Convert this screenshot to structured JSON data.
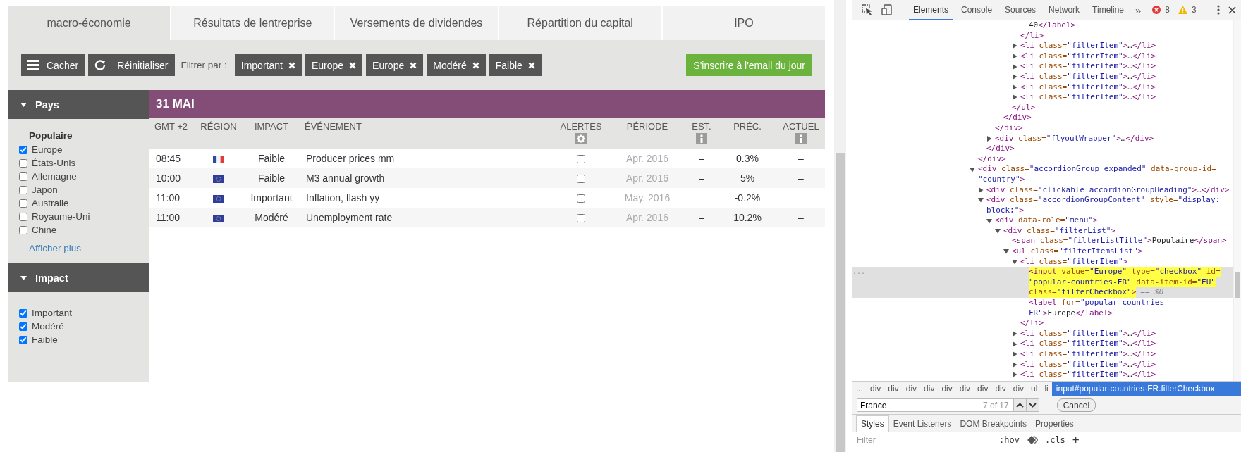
{
  "page": {
    "tabs": [
      {
        "label": "macro-économie",
        "selected": true
      },
      {
        "label": "Résultats de lentreprise",
        "selected": false
      },
      {
        "label": "Versements de dividendes",
        "selected": false
      },
      {
        "label": "Répartition du capital",
        "selected": false
      },
      {
        "label": "IPO",
        "selected": false
      }
    ],
    "toolbar": {
      "hide_button": "Cacher",
      "reset_button": "Réinitialiser",
      "filter_label": "Filtrer par :",
      "filters": [
        "Important",
        "Europe",
        "Europe",
        "Modéré",
        "Faible"
      ],
      "subscribe_button": "S'inscrire à l'email du jour"
    },
    "sidebar": [
      {
        "title": "Pays",
        "expanded": true,
        "subtitle": "Populaire",
        "items": [
          {
            "label": "Europe",
            "checked": true
          },
          {
            "label": "États-Unis",
            "checked": false
          },
          {
            "label": "Allemagne",
            "checked": false
          },
          {
            "label": "Japon",
            "checked": false
          },
          {
            "label": "Australie",
            "checked": false
          },
          {
            "label": "Royaume-Uni",
            "checked": false
          },
          {
            "label": "Chine",
            "checked": false
          }
        ],
        "more_link": "Afficher plus"
      },
      {
        "title": "Impact",
        "expanded": true,
        "items": [
          {
            "label": "Important",
            "checked": true
          },
          {
            "label": "Modéré",
            "checked": true
          },
          {
            "label": "Faible",
            "checked": true
          }
        ]
      }
    ],
    "calendar": {
      "date": "31 MAI",
      "columns": [
        {
          "label": "GMT +2",
          "kind": "plain"
        },
        {
          "label": "RÉGION",
          "kind": "plain"
        },
        {
          "label": "IMPACT",
          "kind": "plain"
        },
        {
          "label": "ÉVÉNEMENT",
          "kind": "plain"
        },
        {
          "label": "ALERTES",
          "kind": "settings"
        },
        {
          "label": "PÉRIODE",
          "kind": "plain"
        },
        {
          "label": "EST.",
          "kind": "info"
        },
        {
          "label": "PRÉC.",
          "kind": "plain"
        },
        {
          "label": "ACTUEL",
          "kind": "info"
        }
      ],
      "rows": [
        {
          "time": "08:45",
          "region": {
            "kind": "fr"
          },
          "impact": "Faible",
          "event": "Producer prices mm",
          "alert": false,
          "period": "Apr. 2016",
          "estimate": "–",
          "previous": "0.3%",
          "actual": "–"
        },
        {
          "time": "10:00",
          "region": {
            "kind": "eu"
          },
          "impact": "Faible",
          "event": "M3 annual growth",
          "alert": false,
          "period": "Apr. 2016",
          "estimate": "–",
          "previous": "5%",
          "actual": "–"
        },
        {
          "time": "11:00",
          "region": {
            "kind": "eu"
          },
          "impact": "Important",
          "event": "Inflation, flash yy",
          "alert": false,
          "period": "May. 2016",
          "estimate": "–",
          "previous": "-0.2%",
          "actual": "–"
        },
        {
          "time": "11:00",
          "region": {
            "kind": "eu"
          },
          "impact": "Modéré",
          "event": "Unemployment rate",
          "alert": false,
          "period": "Apr. 2016",
          "estimate": "–",
          "previous": "10.2%",
          "actual": "–"
        }
      ]
    }
  },
  "devtools": {
    "tabs": [
      {
        "label": "Elements",
        "selected": true
      },
      {
        "label": "Console",
        "selected": false
      },
      {
        "label": "Sources",
        "selected": false
      },
      {
        "label": "Network",
        "selected": false
      },
      {
        "label": "Timeline",
        "selected": false
      }
    ],
    "more_tabs": "»",
    "errors": "8",
    "warnings": "3",
    "dom_tree": [
      {
        "children": [
          {
            "children": [
              {
                "children": [
                  {
                    "children": [
                      {
                        "children": [
                          {
                            "children": [
                              {
                                "lines": [
                                  [
                                    {
                                      "kind": "text",
                                      "text": "40"
                                    },
                                    {
                                      "kind": "tag",
                                      "text": "</label>"
                                    }
                                  ]
                                ],
                                "selected": false,
                                "search_match": false
                              }
                            ],
                            "close": [
                              {
                                "kind": "tag",
                                "text": "</li>"
                              }
                            ]
                          },
                          {
                            "lines": [
                              [
                                {
                                  "kind": "tag",
                                  "text": "<li"
                                },
                                {
                                  "kind": "attr",
                                  "text": " class="
                                },
                                {
                                  "kind": "value",
                                  "text": "\"filterItem\""
                                },
                                {
                                  "kind": "tag",
                                  "text": ">"
                                },
                                {
                                  "kind": "text",
                                  "text": "…"
                                },
                                {
                                  "kind": "tag",
                                  "text": "</li>"
                                }
                              ]
                            ],
                            "expanded": false,
                            "selected": false,
                            "search_match": false
                          },
                          {
                            "lines": [
                              [
                                {
                                  "kind": "tag",
                                  "text": "<li"
                                },
                                {
                                  "kind": "attr",
                                  "text": " class="
                                },
                                {
                                  "kind": "value",
                                  "text": "\"filterItem\""
                                },
                                {
                                  "kind": "tag",
                                  "text": ">"
                                },
                                {
                                  "kind": "text",
                                  "text": "…"
                                },
                                {
                                  "kind": "tag",
                                  "text": "</li>"
                                }
                              ]
                            ],
                            "expanded": false,
                            "selected": false,
                            "search_match": false
                          },
                          {
                            "lines": [
                              [
                                {
                                  "kind": "tag",
                                  "text": "<li"
                                },
                                {
                                  "kind": "attr",
                                  "text": " class="
                                },
                                {
                                  "kind": "value",
                                  "text": "\"filterItem\""
                                },
                                {
                                  "kind": "tag",
                                  "text": ">"
                                },
                                {
                                  "kind": "text",
                                  "text": "…"
                                },
                                {
                                  "kind": "tag",
                                  "text": "</li>"
                                }
                              ]
                            ],
                            "expanded": false,
                            "selected": false,
                            "search_match": false
                          },
                          {
                            "lines": [
                              [
                                {
                                  "kind": "tag",
                                  "text": "<li"
                                },
                                {
                                  "kind": "attr",
                                  "text": " class="
                                },
                                {
                                  "kind": "value",
                                  "text": "\"filterItem\""
                                },
                                {
                                  "kind": "tag",
                                  "text": ">"
                                },
                                {
                                  "kind": "text",
                                  "text": "…"
                                },
                                {
                                  "kind": "tag",
                                  "text": "</li>"
                                }
                              ]
                            ],
                            "expanded": false,
                            "selected": false,
                            "search_match": false
                          },
                          {
                            "lines": [
                              [
                                {
                                  "kind": "tag",
                                  "text": "<li"
                                },
                                {
                                  "kind": "attr",
                                  "text": " class="
                                },
                                {
                                  "kind": "value",
                                  "text": "\"filterItem\""
                                },
                                {
                                  "kind": "tag",
                                  "text": ">"
                                },
                                {
                                  "kind": "text",
                                  "text": "…"
                                },
                                {
                                  "kind": "tag",
                                  "text": "</li>"
                                }
                              ]
                            ],
                            "expanded": false,
                            "selected": false,
                            "search_match": false
                          },
                          {
                            "lines": [
                              [
                                {
                                  "kind": "tag",
                                  "text": "<li"
                                },
                                {
                                  "kind": "attr",
                                  "text": " class="
                                },
                                {
                                  "kind": "value",
                                  "text": "\"filterItem\""
                                },
                                {
                                  "kind": "tag",
                                  "text": ">"
                                },
                                {
                                  "kind": "text",
                                  "text": "…"
                                },
                                {
                                  "kind": "tag",
                                  "text": "</li>"
                                }
                              ]
                            ],
                            "expanded": false,
                            "selected": false,
                            "search_match": false
                          }
                        ],
                        "close": [
                          {
                            "kind": "tag",
                            "text": "</ul>"
                          }
                        ]
                      }
                    ],
                    "close": [
                      {
                        "kind": "tag",
                        "text": "</div>"
                      }
                    ]
                  }
                ],
                "close": [
                  {
                    "kind": "tag",
                    "text": "</div>"
                  }
                ]
              },
              {
                "lines": [
                  [
                    {
                      "kind": "tag",
                      "text": "<div"
                    },
                    {
                      "kind": "attr",
                      "text": " class="
                    },
                    {
                      "kind": "value",
                      "text": "\"flyoutWrapper\""
                    },
                    {
                      "kind": "tag",
                      "text": ">"
                    },
                    {
                      "kind": "text",
                      "text": "…"
                    },
                    {
                      "kind": "tag",
                      "text": "</div>"
                    }
                  ]
                ],
                "expanded": false,
                "selected": false,
                "search_match": false
              }
            ],
            "close": [
              {
                "kind": "tag",
                "text": "</div>"
              }
            ]
          }
        ],
        "close": [
          {
            "kind": "tag",
            "text": "</div>"
          }
        ]
      },
      {
        "lines": [
          [
            {
              "kind": "tag",
              "text": "<div"
            },
            {
              "kind": "attr",
              "text": " class="
            },
            {
              "kind": "value",
              "text": "\"accordionGroup expanded\""
            },
            {
              "kind": "attr",
              "text": " data-group-id="
            }
          ],
          [
            {
              "kind": "value",
              "text": "\"country\""
            },
            {
              "kind": "tag",
              "text": ">"
            }
          ]
        ],
        "expanded": true,
        "selected": false,
        "search_match": false,
        "children": [
          {
            "lines": [
              [
                {
                  "kind": "tag",
                  "text": "<div"
                },
                {
                  "kind": "attr",
                  "text": " class="
                },
                {
                  "kind": "value",
                  "text": "\"clickable accordionGroupHeading\""
                },
                {
                  "kind": "tag",
                  "text": ">"
                },
                {
                  "kind": "text",
                  "text": "…"
                },
                {
                  "kind": "tag",
                  "text": "</div>"
                }
              ]
            ],
            "expanded": false,
            "selected": false,
            "search_match": false
          },
          {
            "lines": [
              [
                {
                  "kind": "tag",
                  "text": "<div"
                },
                {
                  "kind": "attr",
                  "text": " class="
                },
                {
                  "kind": "value",
                  "text": "\"accordionGroupContent\""
                },
                {
                  "kind": "attr",
                  "text": " style="
                },
                {
                  "kind": "value",
                  "text": "\"display:"
                }
              ],
              [
                {
                  "kind": "value",
                  "text": "block;\""
                },
                {
                  "kind": "tag",
                  "text": ">"
                }
              ]
            ],
            "expanded": true,
            "selected": false,
            "search_match": false,
            "children": [
              {
                "lines": [
                  [
                    {
                      "kind": "tag",
                      "text": "<div"
                    },
                    {
                      "kind": "attr",
                      "text": " data-role="
                    },
                    {
                      "kind": "value",
                      "text": "\"menu\""
                    },
                    {
                      "kind": "tag",
                      "text": ">"
                    }
                  ]
                ],
                "expanded": true,
                "selected": false,
                "search_match": false,
                "children": [
                  {
                    "lines": [
                      [
                        {
                          "kind": "tag",
                          "text": "<div"
                        },
                        {
                          "kind": "attr",
                          "text": " class="
                        },
                        {
                          "kind": "value",
                          "text": "\"filterList\""
                        },
                        {
                          "kind": "tag",
                          "text": ">"
                        }
                      ]
                    ],
                    "expanded": true,
                    "selected": false,
                    "search_match": false,
                    "children": [
                      {
                        "lines": [
                          [
                            {
                              "kind": "tag",
                              "text": "<span"
                            },
                            {
                              "kind": "attr",
                              "text": " class="
                            },
                            {
                              "kind": "value",
                              "text": "\"filterListTitle\""
                            },
                            {
                              "kind": "tag",
                              "text": ">"
                            },
                            {
                              "kind": "text",
                              "text": "Populaire"
                            },
                            {
                              "kind": "tag",
                              "text": "</span>"
                            }
                          ]
                        ],
                        "selected": false,
                        "search_match": false
                      },
                      {
                        "lines": [
                          [
                            {
                              "kind": "tag",
                              "text": "<ul"
                            },
                            {
                              "kind": "attr",
                              "text": " class="
                            },
                            {
                              "kind": "value",
                              "text": "\"filterItemsList\""
                            },
                            {
                              "kind": "tag",
                              "text": ">"
                            }
                          ]
                        ],
                        "expanded": true,
                        "selected": false,
                        "search_match": false,
                        "children": [
                          {
                            "lines": [
                              [
                                {
                                  "kind": "tag",
                                  "text": "<li"
                                },
                                {
                                  "kind": "attr",
                                  "text": " class="
                                },
                                {
                                  "kind": "value",
                                  "text": "\"filterItem\""
                                },
                                {
                                  "kind": "tag",
                                  "text": ">"
                                }
                              ]
                            ],
                            "expanded": true,
                            "selected": false,
                            "search_match": false,
                            "children": [
                              {
                                "lines": [
                                  [
                                    {
                                      "kind": "tag",
                                      "text": "<input"
                                    },
                                    {
                                      "kind": "attr",
                                      "text": " value="
                                    },
                                    {
                                      "kind": "value",
                                      "text": "\"Europe\""
                                    },
                                    {
                                      "kind": "attr",
                                      "text": " type="
                                    },
                                    {
                                      "kind": "value",
                                      "text": "\"checkbox\""
                                    },
                                    {
                                      "kind": "attr",
                                      "text": " id="
                                    }
                                  ],
                                  [
                                    {
                                      "kind": "value",
                                      "text": "\"popular-countries-FR\""
                                    },
                                    {
                                      "kind": "attr",
                                      "text": " data-item-id="
                                    },
                                    {
                                      "kind": "value",
                                      "text": "\"EU\""
                                    }
                                  ],
                                  [
                                    {
                                      "kind": "attr",
                                      "text": "class="
                                    },
                                    {
                                      "kind": "value",
                                      "text": "\"filterCheckbox\""
                                    },
                                    {
                                      "kind": "tag",
                                      "text": ">"
                                    }
                                  ]
                                ],
                                "selected": true,
                                "search_match": true,
                                "gutter": "...",
                                "console_ref": "== $0"
                              },
                              {
                                "lines": [
                                  [
                                    {
                                      "kind": "tag",
                                      "text": "<label"
                                    },
                                    {
                                      "kind": "attr",
                                      "text": " for="
                                    },
                                    {
                                      "kind": "value",
                                      "text": "\"popular-countries-"
                                    }
                                  ],
                                  [
                                    {
                                      "kind": "value",
                                      "text": "FR\""
                                    },
                                    {
                                      "kind": "tag",
                                      "text": ">"
                                    },
                                    {
                                      "kind": "text",
                                      "text": "Europe"
                                    },
                                    {
                                      "kind": "tag",
                                      "text": "</label>"
                                    }
                                  ]
                                ],
                                "selected": false,
                                "search_match": false
                              }
                            ],
                            "close": [
                              {
                                "kind": "tag",
                                "text": "</li>"
                              }
                            ]
                          },
                          {
                            "lines": [
                              [
                                {
                                  "kind": "tag",
                                  "text": "<li"
                                },
                                {
                                  "kind": "attr",
                                  "text": " class="
                                },
                                {
                                  "kind": "value",
                                  "text": "\"filterItem\""
                                },
                                {
                                  "kind": "tag",
                                  "text": ">"
                                },
                                {
                                  "kind": "text",
                                  "text": "…"
                                },
                                {
                                  "kind": "tag",
                                  "text": "</li>"
                                }
                              ]
                            ],
                            "expanded": false,
                            "selected": false,
                            "search_match": false
                          },
                          {
                            "lines": [
                              [
                                {
                                  "kind": "tag",
                                  "text": "<li"
                                },
                                {
                                  "kind": "attr",
                                  "text": " class="
                                },
                                {
                                  "kind": "value",
                                  "text": "\"filterItem\""
                                },
                                {
                                  "kind": "tag",
                                  "text": ">"
                                },
                                {
                                  "kind": "text",
                                  "text": "…"
                                },
                                {
                                  "kind": "tag",
                                  "text": "</li>"
                                }
                              ]
                            ],
                            "expanded": false,
                            "selected": false,
                            "search_match": false
                          },
                          {
                            "lines": [
                              [
                                {
                                  "kind": "tag",
                                  "text": "<li"
                                },
                                {
                                  "kind": "attr",
                                  "text": " class="
                                },
                                {
                                  "kind": "value",
                                  "text": "\"filterItem\""
                                },
                                {
                                  "kind": "tag",
                                  "text": ">"
                                },
                                {
                                  "kind": "text",
                                  "text": "…"
                                },
                                {
                                  "kind": "tag",
                                  "text": "</li>"
                                }
                              ]
                            ],
                            "expanded": false,
                            "selected": false,
                            "search_match": false
                          },
                          {
                            "lines": [
                              [
                                {
                                  "kind": "tag",
                                  "text": "<li"
                                },
                                {
                                  "kind": "attr",
                                  "text": " class="
                                },
                                {
                                  "kind": "value",
                                  "text": "\"filterItem\""
                                },
                                {
                                  "kind": "tag",
                                  "text": ">"
                                },
                                {
                                  "kind": "text",
                                  "text": "…"
                                },
                                {
                                  "kind": "tag",
                                  "text": "</li>"
                                }
                              ]
                            ],
                            "expanded": false,
                            "selected": false,
                            "search_match": false
                          },
                          {
                            "lines": [
                              [
                                {
                                  "kind": "tag",
                                  "text": "<li"
                                },
                                {
                                  "kind": "attr",
                                  "text": " class="
                                },
                                {
                                  "kind": "value",
                                  "text": "\"filterItem\""
                                },
                                {
                                  "kind": "tag",
                                  "text": ">"
                                },
                                {
                                  "kind": "text",
                                  "text": "…"
                                },
                                {
                                  "kind": "tag",
                                  "text": "</li>"
                                }
                              ]
                            ],
                            "expanded": false,
                            "selected": false,
                            "search_match": false
                          }
                        ]
                      }
                    ]
                  }
                ]
              }
            ]
          }
        ]
      }
    ],
    "breadcrumb": {
      "more": "...",
      "items": [
        {
          "label": "div",
          "selected": false
        },
        {
          "label": "div",
          "selected": false
        },
        {
          "label": "div",
          "selected": false
        },
        {
          "label": "div",
          "selected": false
        },
        {
          "label": "div",
          "selected": false
        },
        {
          "label": "div",
          "selected": false
        },
        {
          "label": "div",
          "selected": false
        },
        {
          "label": "div",
          "selected": false
        },
        {
          "label": "div",
          "selected": false
        },
        {
          "label": "ul",
          "selected": false
        },
        {
          "label": "li",
          "selected": false
        },
        {
          "label": "input#popular-countries-FR.filterCheckbox",
          "selected": true
        }
      ]
    },
    "search": {
      "value": "France",
      "count": "7 of 17",
      "cancel_button": "Cancel"
    },
    "panel_tabs": [
      {
        "label": "Styles",
        "selected": true
      },
      {
        "label": "Event Listeners",
        "selected": false
      },
      {
        "label": "DOM Breakpoints",
        "selected": false
      },
      {
        "label": "Properties",
        "selected": false
      }
    ],
    "styles_filter": {
      "placeholder": "Filter",
      "hov": ":hov",
      "cls": ".cls",
      "add": "+"
    }
  }
}
